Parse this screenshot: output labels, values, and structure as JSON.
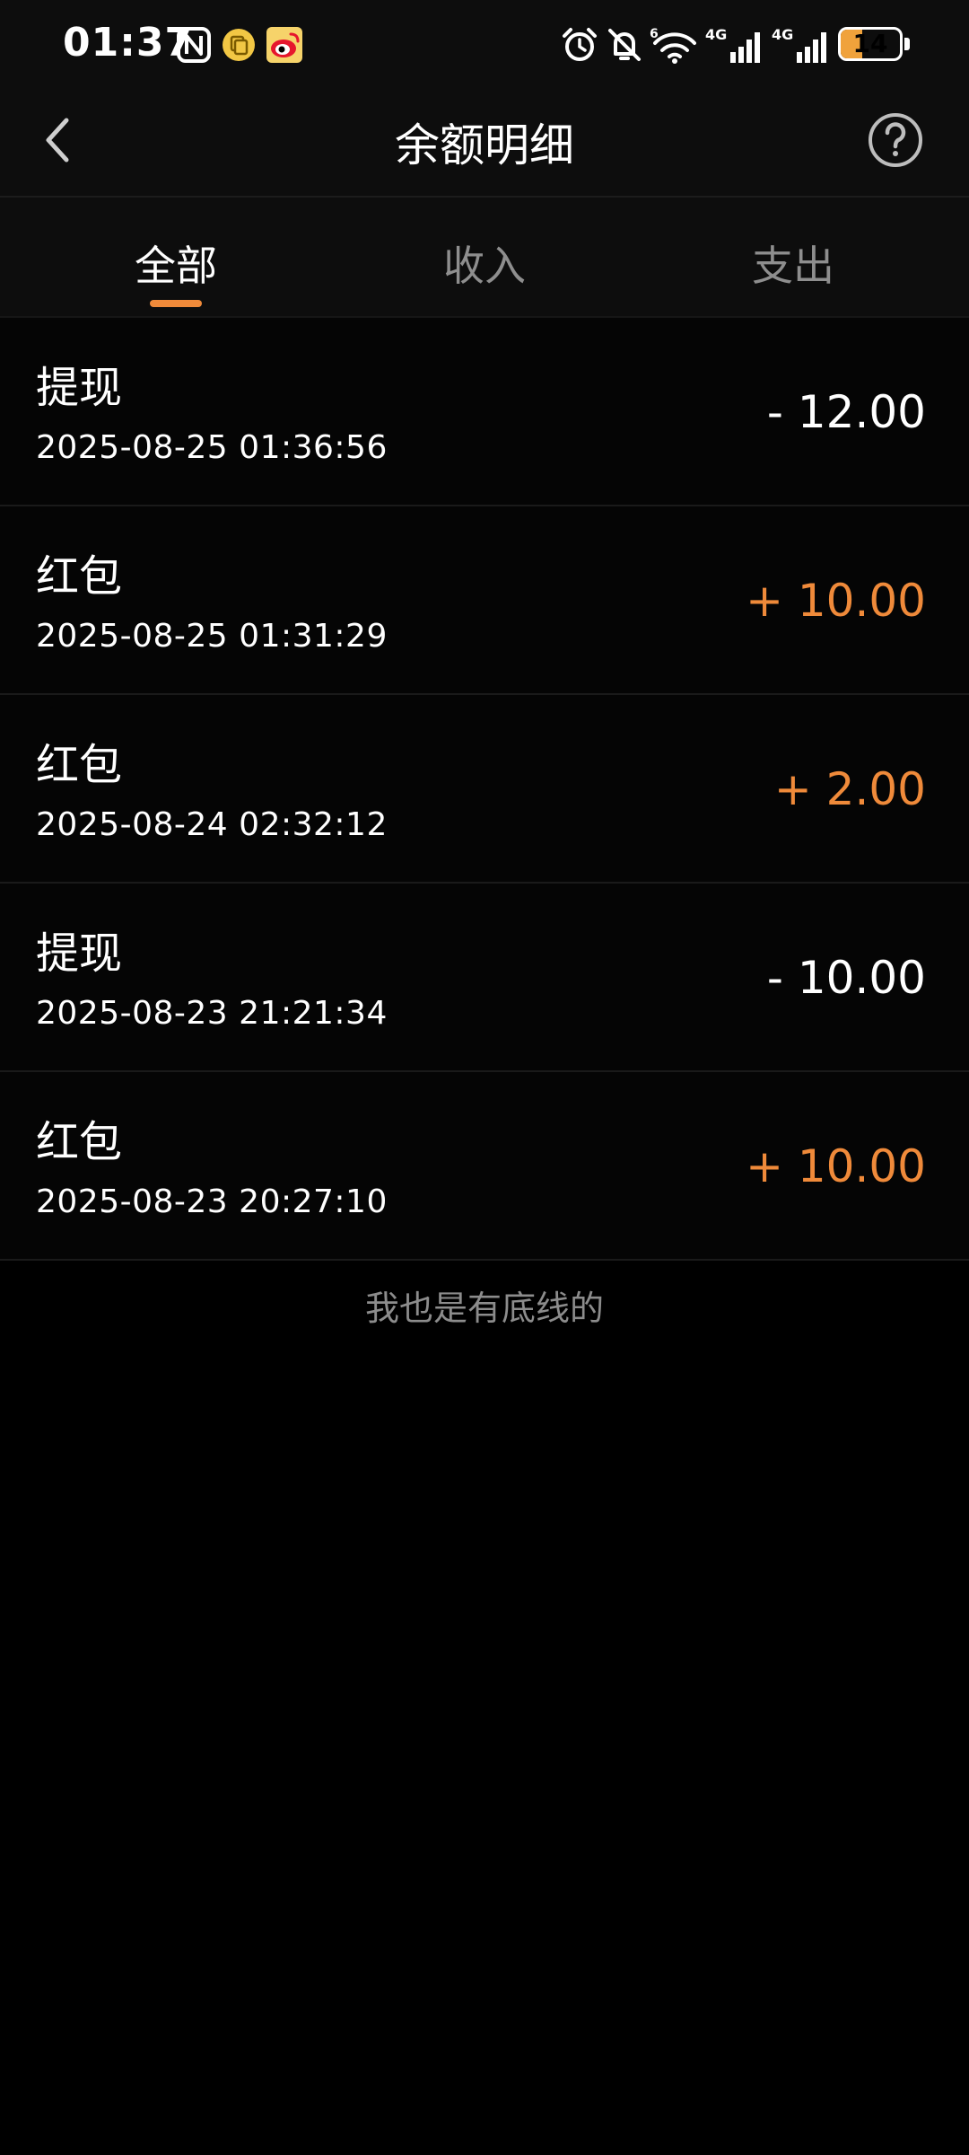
{
  "status_bar": {
    "time": "01:37",
    "battery_level": "14",
    "battery_fraction": 0.14,
    "icons": [
      "nfc-icon",
      "app-notification-icon",
      "weibo-icon",
      "alarm-icon",
      "mute-icon",
      "wifi-6-icon",
      "signal-4g-icon",
      "signal-4g-icon",
      "battery-icon"
    ]
  },
  "header": {
    "title": "余额明细"
  },
  "tabs": [
    {
      "label": "全部",
      "active": true
    },
    {
      "label": "收入",
      "active": false
    },
    {
      "label": "支出",
      "active": false
    }
  ],
  "records": [
    {
      "title": "提现",
      "time": "2025-08-25 01:36:56",
      "amount": "- 12.00",
      "type": "expense"
    },
    {
      "title": "红包",
      "time": "2025-08-25 01:31:29",
      "amount": "+ 10.00",
      "type": "income"
    },
    {
      "title": "红包",
      "time": "2025-08-24 02:32:12",
      "amount": "+ 2.00",
      "type": "income"
    },
    {
      "title": "提现",
      "time": "2025-08-23 21:21:34",
      "amount": "- 10.00",
      "type": "expense"
    },
    {
      "title": "红包",
      "time": "2025-08-23 20:27:10",
      "amount": "+ 10.00",
      "type": "income"
    }
  ],
  "footer": {
    "text": "我也是有底线的"
  },
  "colors": {
    "accent": "#ef8a3a",
    "income": "#ef8a3a",
    "expense": "#ffffff",
    "background": "#000000",
    "tab_inactive": "#8e8e8e"
  }
}
